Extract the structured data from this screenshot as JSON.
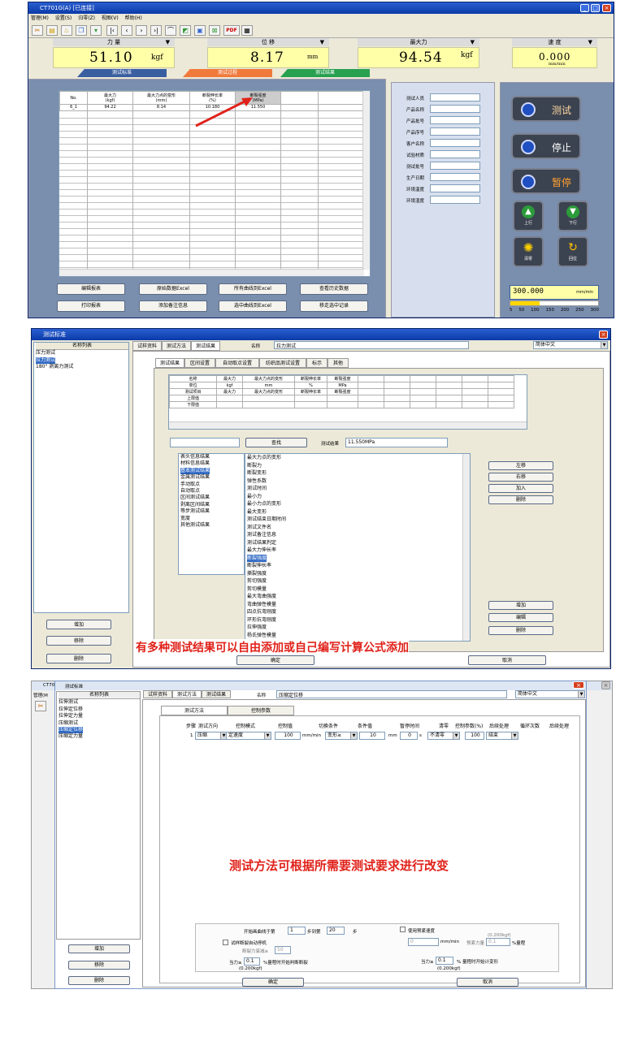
{
  "colors": {
    "accent": "#0a3aa8",
    "gauge_bg": "#ffffa8",
    "red": "#e0221a",
    "tab_blue": "#3a5fa0",
    "tab_orange": "#f07a3c",
    "tab_green": "#27a050"
  },
  "main": {
    "title": "CT701G(A)   [已连接]",
    "menu": [
      "管理(M)",
      "设置(S)",
      "归零(Z)",
      "视图(V)",
      "帮助(H)"
    ],
    "toolbar_icons": [
      "tools-icon",
      "folder-icon",
      "bell-icon",
      "copy-icon",
      "trash-icon",
      "first-icon",
      "prev-icon",
      "next-icon",
      "last-icon",
      "curve-icon",
      "chart-icon",
      "image-icon",
      "excel-icon",
      "pdf-icon",
      "calc-icon"
    ],
    "gauges": [
      {
        "label": "力  量",
        "value": "51.10",
        "unit": "kgf"
      },
      {
        "label": "位  移",
        "value": "8.17",
        "unit": "mm"
      },
      {
        "label": "最大力",
        "value": "94.54",
        "unit": "kgf"
      },
      {
        "label": "速  度",
        "value": "0.000",
        "unit": "mm/min"
      }
    ],
    "tabs": [
      "测试标准",
      "测试过程",
      "测试结果"
    ],
    "table": {
      "headers": [
        [
          "No."
        ],
        [
          "最大力",
          "(kgf)"
        ],
        [
          "最大力点的变形",
          "(mm)"
        ],
        [
          "断裂伸长率",
          "(%)"
        ],
        [
          "断裂强度",
          "(MPa)"
        ]
      ],
      "row": [
        "6_1",
        "94.22",
        "8.14",
        "10.180",
        "11.550"
      ]
    },
    "buttons_row1": [
      "编辑报表",
      "原始数据Excel",
      "所有曲线到Excel",
      "查看历史数据"
    ],
    "buttons_row2": [
      "打印报表",
      "添加备注信息",
      "选中曲线到Excel",
      "移走选中记录"
    ],
    "info_fields": [
      "测试人员",
      "产品名称",
      "产品批号",
      "产品序号",
      "客户名称",
      "试验材质",
      "测试批号",
      "生产日期",
      "环境温度",
      "环境湿度"
    ],
    "big_buttons": [
      "测试",
      "停止",
      "暂停"
    ],
    "small_buttons": [
      "上行",
      "下行",
      "清零",
      "回位"
    ],
    "speed": {
      "value": "300.000",
      "unit": "mm/min",
      "ticks": [
        "5",
        "50",
        "100",
        "150",
        "200",
        "250",
        "300"
      ],
      "level": 0.33
    }
  },
  "std": {
    "title": "测试标准",
    "list_header": "名称列表",
    "list_items": [
      "压力测试",
      "拉力测试",
      "180° 剥离力测试"
    ],
    "top_tabs": [
      "试样资料",
      "测试方法",
      "测试结果"
    ],
    "name_label": "名称",
    "name_value": "拉力测试",
    "lang": "简体中文",
    "sub_tabs": [
      "测试结果",
      "区间设置",
      "自动取点设置",
      "纺织品测试设置",
      "标示",
      "其他"
    ],
    "result_table": {
      "rows": [
        [
          "名称",
          "最大力",
          "最大力点的变形",
          "断裂伸长率",
          "断裂强度"
        ],
        [
          "单位",
          "kgf",
          "mm",
          "%",
          "MPa"
        ],
        [
          "测试项目",
          "最大力",
          "最大力点的变形",
          "断裂伸长率",
          "断裂强度"
        ],
        [
          "上限值",
          "",
          "",
          "",
          ""
        ],
        [
          "下限值",
          "",
          "",
          "",
          ""
        ]
      ]
    },
    "find_btn": "查找",
    "result_label": "测试结果",
    "result_value": "11.550MPa",
    "categories": [
      "表头信息结果",
      "材料信息结果",
      "基本测试结果",
      "金属测试结果",
      "手动取点",
      "自动取点",
      "区间测试结果",
      "剥离区间结果",
      "等步测试结果",
      "宽度",
      "其他测试结果"
    ],
    "results": [
      "最大力点的变形",
      "断裂力",
      "断裂变形",
      "弹性系数",
      "测试时间",
      "最小力",
      "最小力点的变形",
      "最大变形",
      "测试结束日期时间",
      "测试文件名",
      "测试备注信息",
      "测试结果判定",
      "最大力伸长率",
      "断裂强度",
      "断裂伸长率",
      "撕裂强度",
      "剪切强度",
      "剪切模量",
      "最大弯曲强度",
      "弯曲弹性模量",
      "四点抗弯刚度",
      "环形抗弯刚度",
      "拉伸强度",
      "杨氏弹性模量"
    ],
    "side_btns": [
      "左移",
      "右移",
      "加入",
      "删除"
    ],
    "side_btns2": [
      "增加",
      "编辑",
      "删除"
    ],
    "left_btns": [
      "增加",
      "移除",
      "删除"
    ],
    "ok": "确定",
    "cancel": "取消",
    "caption": "有多种测试结果可以自由添加或自己编写计算公式添加"
  },
  "method": {
    "title": "测试标准",
    "bg_title": "CT70",
    "bg_menu": "管理(M",
    "list_header": "名称列表",
    "list_items": [
      "拉伸测试",
      "拉伸定位移",
      "拉伸定力量",
      "压缩测试",
      "压缩定位移",
      "压缩定力量"
    ],
    "top_tabs": [
      "试样资料",
      "测试方法",
      "测试结果"
    ],
    "name_label": "名称",
    "name_value": "压缩定位移",
    "lang": "简体中文",
    "sub_tabs": [
      "测试方法",
      "控制参数"
    ],
    "cols": [
      "步骤",
      "测试方向",
      "控制模式",
      "控制值",
      "切换条件",
      "条件值",
      "暂停时间",
      "清零",
      "控制参数(%)",
      "后续处理",
      "循环次数",
      "后续处理"
    ],
    "row": {
      "step": "1",
      "dir": "压缩",
      "mode": "定速度",
      "ctrl_val": "100",
      "unit1": "mm/min",
      "cond": "变形≥",
      "cond_val": "10",
      "unit2": "mm",
      "pause": "0",
      "unit3": "s",
      "zero": "不清零",
      "param": "100",
      "after": "结束"
    },
    "caption": "测试方法可根据所需要测试要求进行改变",
    "bottom": {
      "start_label": "开始画曲线于第",
      "start_val": "1",
      "step_to": "步到第",
      "end_val": "20",
      "step": "步",
      "preload_label": "使用预紧速度",
      "preload_hint": "(0.200kgf)",
      "preload_val": "0",
      "preload_unit": "mm/min",
      "preload_force": "预紧力量",
      "preload_force_val": "0.1",
      "pct": "%量程",
      "break_label": "试样断裂自动停机",
      "break_sub": "断裂力衰减≥",
      "break_sub_val": "50",
      "force_label": "当力≥",
      "force_val": "0.1",
      "force_tail": "%量程时开始判断断裂",
      "force_kgf": "(0.200kgf)",
      "force2_label": "当力≥",
      "force2_val": "0.1",
      "force2_tail": "% 量程时开始计变形",
      "force2_kgf": "(0.200kgf)"
    },
    "left_btns": [
      "增加",
      "移除",
      "删除"
    ],
    "ok": "确定",
    "cancel": "取消"
  }
}
